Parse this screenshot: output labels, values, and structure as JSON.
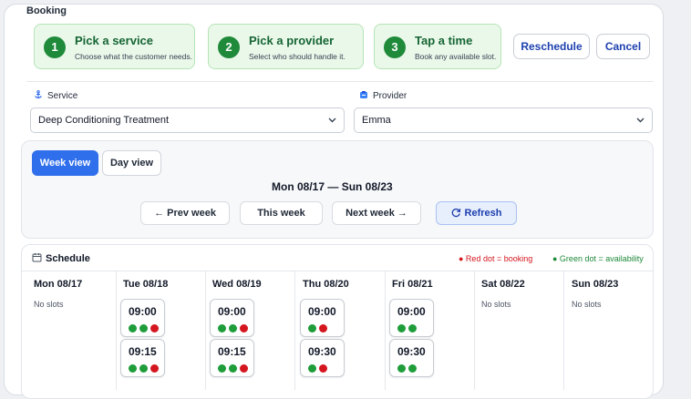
{
  "booking": {
    "title": "Booking",
    "steps": [
      {
        "num": "1",
        "title": "Pick a service",
        "subtitle": "Choose what the customer needs."
      },
      {
        "num": "2",
        "title": "Pick a provider",
        "subtitle": "Select who should handle it."
      },
      {
        "num": "3",
        "title": "Tap a time",
        "subtitle": "Book any available slot."
      }
    ],
    "reschedule_label": "Reschedule",
    "cancel_label": "Cancel"
  },
  "service": {
    "label": "Service",
    "value": "Deep Conditioning Treatment",
    "icon": "anchor-icon"
  },
  "provider": {
    "label": "Provider",
    "value": "Emma",
    "icon": "provider-icon"
  },
  "views": {
    "week_label": "Week view",
    "day_label": "Day view",
    "active": "week"
  },
  "range": "Mon 08/17 — Sun 08/23",
  "nav": {
    "prev": "← Prev week",
    "this": "This week",
    "next": "Next week →",
    "refresh": "Refresh"
  },
  "schedule": {
    "title": "Schedule",
    "legend_red": "● Red dot = booking",
    "legend_green": "● Green dot = availability",
    "colors": {
      "green": "#1f9d3a",
      "red": "#d4161f",
      "accent": "#2f6fec"
    },
    "no_slots": "No slots",
    "days": [
      {
        "label": "Mon 08/17",
        "slots": []
      },
      {
        "label": "Tue 08/18",
        "slots": [
          {
            "time": "09:00",
            "dots": [
              "g",
              "g",
              "r"
            ]
          },
          {
            "time": "09:15",
            "dots": [
              "g",
              "g",
              "r"
            ]
          }
        ]
      },
      {
        "label": "Wed 08/19",
        "slots": [
          {
            "time": "09:00",
            "dots": [
              "g",
              "g",
              "r"
            ]
          },
          {
            "time": "09:15",
            "dots": [
              "g",
              "g",
              "r"
            ]
          }
        ]
      },
      {
        "label": "Thu 08/20",
        "slots": [
          {
            "time": "09:00",
            "dots": [
              "g",
              "r"
            ]
          },
          {
            "time": "09:30",
            "dots": [
              "g",
              "r"
            ]
          }
        ]
      },
      {
        "label": "Fri 08/21",
        "slots": [
          {
            "time": "09:00",
            "dots": [
              "g",
              "g"
            ]
          },
          {
            "time": "09:30",
            "dots": [
              "g",
              "g"
            ]
          }
        ]
      },
      {
        "label": "Sat 08/22",
        "slots": []
      },
      {
        "label": "Sun 08/23",
        "slots": []
      }
    ]
  }
}
